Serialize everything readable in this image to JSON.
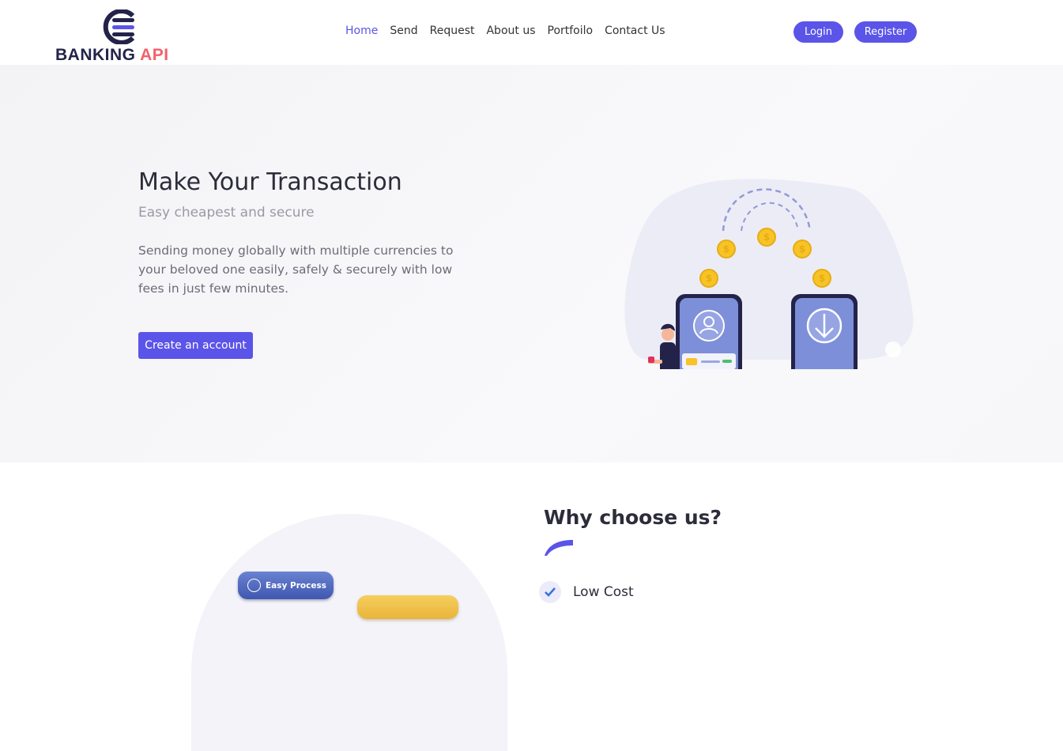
{
  "brand": {
    "logo_word": "BANKING",
    "logo_accent": "API"
  },
  "nav": {
    "items": [
      {
        "label": "Home",
        "active": true
      },
      {
        "label": "Send"
      },
      {
        "label": "Request"
      },
      {
        "label": "About us"
      },
      {
        "label": "Portfoilo"
      },
      {
        "label": "Contact Us"
      }
    ],
    "login_label": "Login",
    "register_label": "Register"
  },
  "hero": {
    "title": "Make Your Transaction",
    "subtitle": "Easy cheapest and secure",
    "description": "Sending money globally with multiple currencies to your beloved one easily, safely & securely with low fees in just few minutes.",
    "cta_label": "Create an account"
  },
  "why": {
    "title": "Why choose us?",
    "badge_label": "Easy Process",
    "items": [
      {
        "label": "Low Cost"
      }
    ]
  },
  "colors": {
    "accent": "#5b54e8",
    "brand_dark": "#23234a",
    "brand_red": "#f0626b",
    "coin": "#f7c325"
  }
}
